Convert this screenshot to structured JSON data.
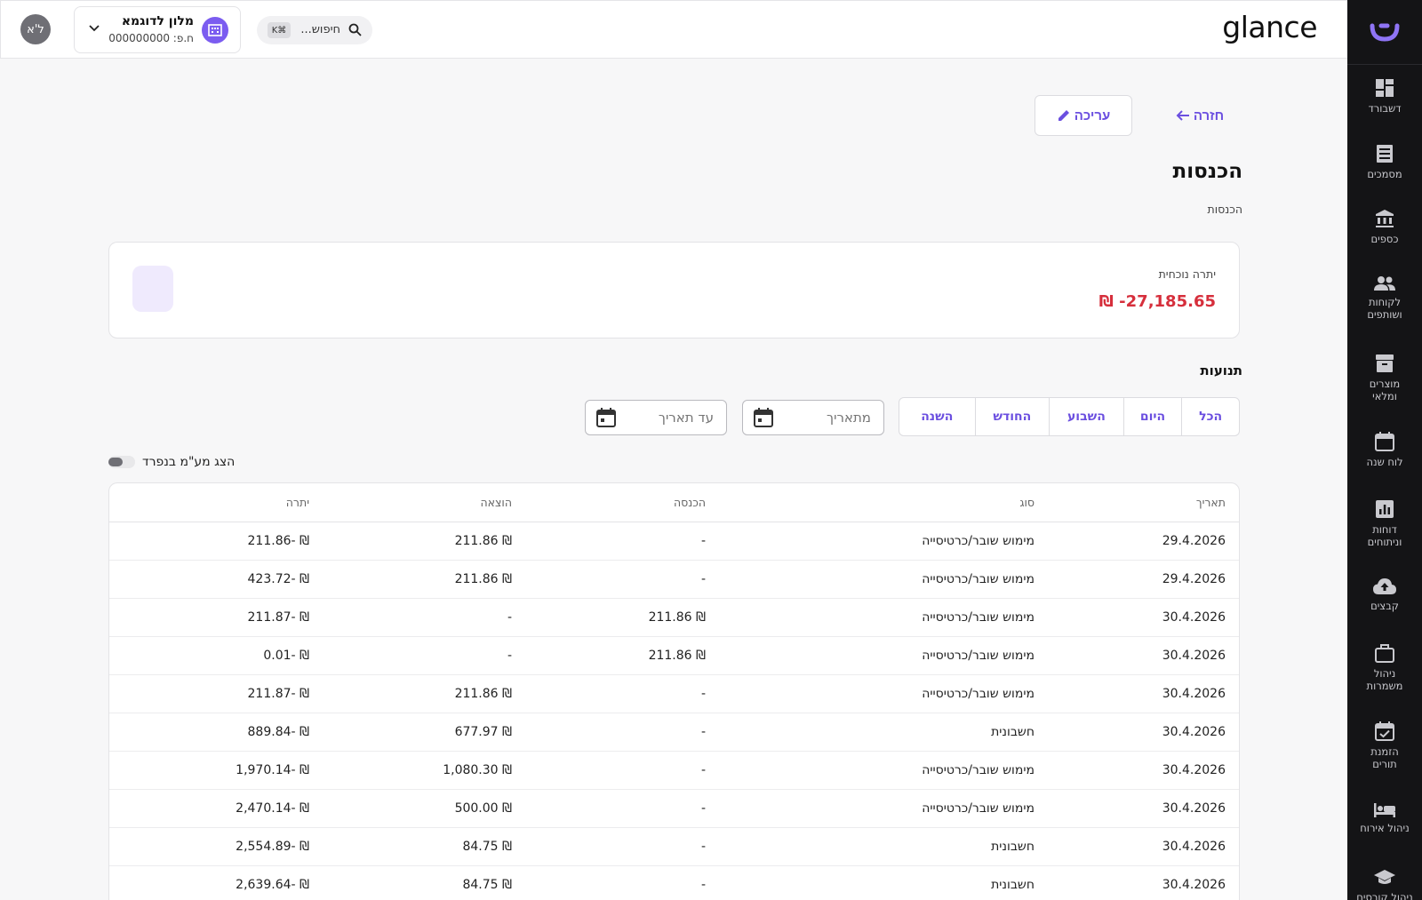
{
  "brand": "glance",
  "topbar": {
    "avatar_initials": "ל'א",
    "hotel_name": "מלון לדוגמא",
    "hotel_id": "ח.פ: 000000000",
    "search_placeholder": "חיפוש...",
    "search_shortcut": "K⌘"
  },
  "sidebar": {
    "items": [
      {
        "label": "דשבורד",
        "icon": "dashboard-icon"
      },
      {
        "label": "מסמכים",
        "icon": "documents-icon"
      },
      {
        "label": "כספים",
        "icon": "bank-icon"
      },
      {
        "label": "לקוחות ושותפים",
        "icon": "people-icon"
      },
      {
        "label": "מוצרים ומלאי",
        "icon": "archive-icon"
      },
      {
        "label": "לוח שנה",
        "icon": "calendar-icon"
      },
      {
        "label": "דוחות וניתוחים",
        "icon": "report-icon"
      },
      {
        "label": "קבצים",
        "icon": "cloud-upload-icon"
      },
      {
        "label": "ניהול משמרות",
        "icon": "briefcase-icon"
      },
      {
        "label": "הזמנת תורים",
        "icon": "calendar-check-icon"
      },
      {
        "label": "ניהול אירוח",
        "icon": "bed-icon"
      },
      {
        "label": "ניהול קורסים",
        "icon": "school-icon"
      }
    ]
  },
  "actions": {
    "back": "חזרה",
    "edit": "עריכה"
  },
  "page": {
    "title": "הכנסות",
    "breadcrumb": "הכנסות"
  },
  "balance": {
    "label": "יתרה נוכחית",
    "value": "₪ -27,185.65",
    "color": "#d62f3c"
  },
  "transactions": {
    "title": "תנועות",
    "filters": [
      "הכל",
      "היום",
      "השבוע",
      "החודש",
      "השנה"
    ],
    "from_placeholder": "מתאריך",
    "to_placeholder": "עד תאריך",
    "vat_toggle_label": "הצג מע\"מ בנפרד",
    "columns": [
      "תאריך",
      "סוג",
      "הכנסה",
      "הוצאה",
      "יתרה"
    ],
    "rows": [
      [
        "29.4.2026",
        "מימוש שובר/כרטיסייה",
        "-",
        "₪ 211.86",
        "₪ -211.86"
      ],
      [
        "29.4.2026",
        "מימוש שובר/כרטיסייה",
        "-",
        "₪ 211.86",
        "₪ -423.72"
      ],
      [
        "30.4.2026",
        "מימוש שובר/כרטיסייה",
        "₪ 211.86",
        "-",
        "₪ -211.87"
      ],
      [
        "30.4.2026",
        "מימוש שובר/כרטיסייה",
        "₪ 211.86",
        "-",
        "₪ -0.01"
      ],
      [
        "30.4.2026",
        "מימוש שובר/כרטיסייה",
        "-",
        "₪ 211.86",
        "₪ -211.87"
      ],
      [
        "30.4.2026",
        "חשבונית",
        "-",
        "₪ 677.97",
        "₪ -889.84"
      ],
      [
        "30.4.2026",
        "מימוש שובר/כרטיסייה",
        "-",
        "₪ 1,080.30",
        "₪ -1,970.14"
      ],
      [
        "30.4.2026",
        "מימוש שובר/כרטיסייה",
        "-",
        "₪ 500.00",
        "₪ -2,470.14"
      ],
      [
        "30.4.2026",
        "חשבונית",
        "-",
        "₪ 84.75",
        "₪ -2,554.89"
      ],
      [
        "30.4.2026",
        "חשבונית",
        "-",
        "₪ 84.75",
        "₪ -2,639.64"
      ]
    ]
  },
  "colors": {
    "accent": "#6b4fe0",
    "sidebar_bg": "#141416",
    "negative": "#d62f3c"
  }
}
